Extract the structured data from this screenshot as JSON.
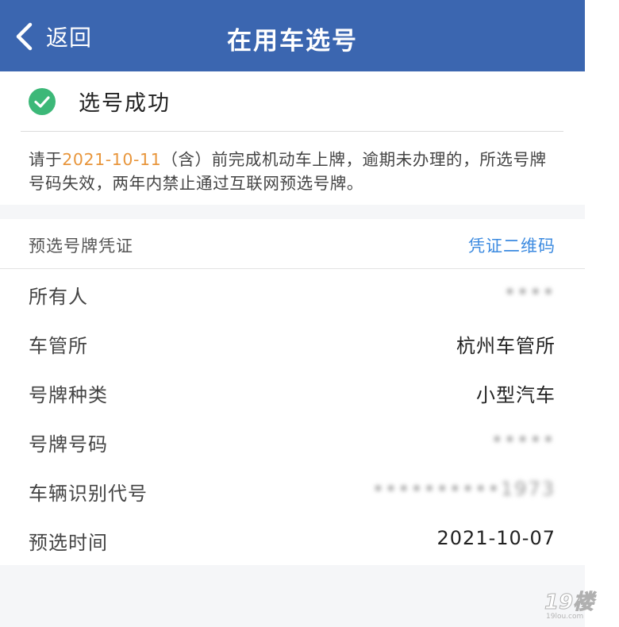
{
  "header": {
    "back_label": "返回",
    "title": "在用车选号"
  },
  "success": {
    "text": "选号成功"
  },
  "notice": {
    "prefix": "请于",
    "date": "2021-10-11",
    "suffix": "（含）前完成机动车上牌，逾期未办理的，所选号牌号码失效，两年内禁止通过互联网预选号牌。"
  },
  "certificate": {
    "section_title": "预选号牌凭证",
    "qr_link": "凭证二维码",
    "rows": [
      {
        "label": "所有人",
        "value": "••••",
        "blurred": true
      },
      {
        "label": "车管所",
        "value": "杭州车管所",
        "blurred": false
      },
      {
        "label": "号牌种类",
        "value": "小型汽车",
        "blurred": false
      },
      {
        "label": "号牌号码",
        "value": "•••••",
        "blurred": true
      },
      {
        "label": "车辆识别代号",
        "value": "••••••••••1973",
        "blurred": true
      },
      {
        "label": "预选时间",
        "value": "2021-10-07",
        "blurred": false
      }
    ]
  },
  "watermark": {
    "text": "19楼",
    "subtext": "19lou.com"
  },
  "colors": {
    "header_bg": "#3b66b0",
    "success_green": "#3cb878",
    "date_orange": "#e8963c",
    "link_blue": "#3d8be0"
  }
}
